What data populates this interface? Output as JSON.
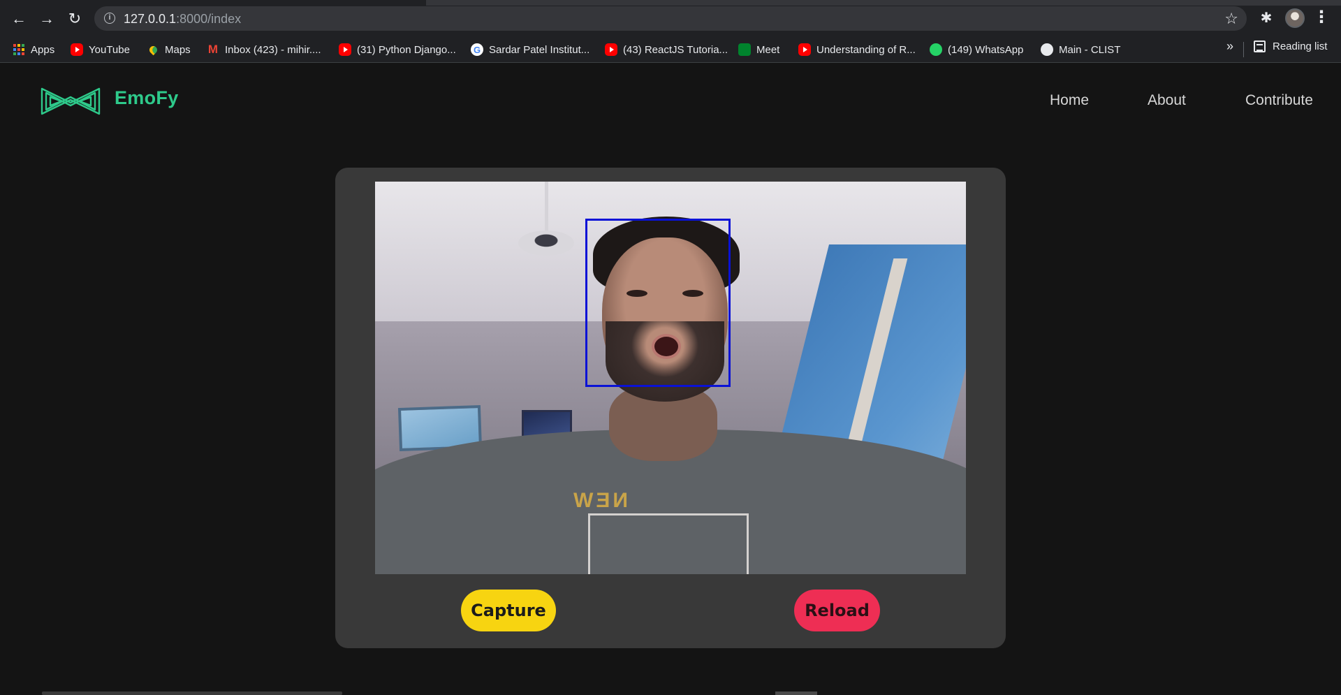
{
  "browser": {
    "url_host": "127.0.0.1",
    "url_path": ":8000/index",
    "bookmarks": [
      {
        "label": "Apps",
        "icon": "apps-grid-icon"
      },
      {
        "label": "YouTube",
        "icon": "youtube-icon"
      },
      {
        "label": "Maps",
        "icon": "maps-pin-icon"
      },
      {
        "label": "Inbox (423) - mihir....",
        "icon": "gmail-icon"
      },
      {
        "label": "(31) Python Django...",
        "icon": "youtube-icon"
      },
      {
        "label": "Sardar Patel Institut...",
        "icon": "google-icon"
      },
      {
        "label": "(43) ReactJS Tutoria...",
        "icon": "youtube-icon"
      },
      {
        "label": "Meet",
        "icon": "meet-icon"
      },
      {
        "label": "Understanding of R...",
        "icon": "youtube-icon"
      },
      {
        "label": "(149) WhatsApp",
        "icon": "whatsapp-icon"
      },
      {
        "label": "Main - CLIST",
        "icon": "globe-icon"
      }
    ],
    "more_bookmarks": "»",
    "reading_list": "Reading list"
  },
  "site": {
    "brand": "EmoFy",
    "nav": {
      "home": "Home",
      "about": "About",
      "contribute": "Contribute"
    }
  },
  "camera": {
    "shirt_text": "NEW"
  },
  "actions": {
    "capture": "Capture",
    "reload": "Reload"
  },
  "colors": {
    "brand": "#2eca8b",
    "capture_button": "#f7d411",
    "reload_button": "#ee2e54",
    "face_box": "#0a12d6",
    "card": "#393939",
    "page_bg": "#141414"
  }
}
